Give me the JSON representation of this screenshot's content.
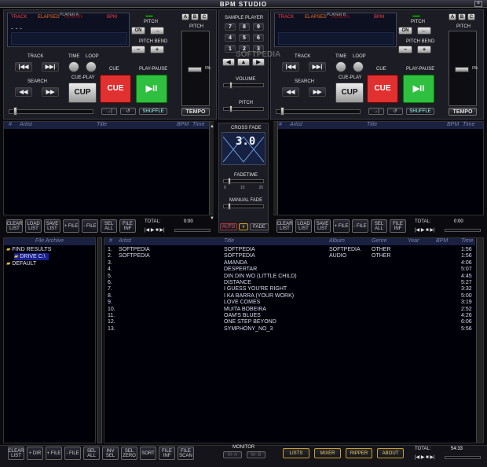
{
  "app": {
    "title": "BPM STUDIO"
  },
  "decks": [
    {
      "player_label": "PLAYER A",
      "lcd": {
        "track": "TRACK",
        "elapsed": "ELAPSED",
        "remain": "REMAIN",
        "bpm": "BPM",
        "track_value": "- - -"
      },
      "pitch": "PITCH",
      "pitch_on": "ON",
      "pitch_arrow": "→",
      "pitch_bend": "PITCH BEND",
      "minus": "−",
      "plus": "+",
      "abc": [
        "A",
        "B",
        "C"
      ],
      "track_lbl": "TRACK",
      "time_lbl": "TIME",
      "loop_lbl": "LOOP",
      "cue_lbl": "CUE",
      "play_pause_lbl": "PLAY-PAUSE",
      "cue_play_lbl": "CUE-PLAY",
      "search_lbl": "SEARCH",
      "cup": "CUP",
      "cue": "CUE",
      "play_glyph": "▶II",
      "shuffle": "SHUFFLE",
      "tempo": "TEMPO",
      "pitch_pct": "0%",
      "prev_glyph": "|◀◀",
      "next_glyph": "▶▶|",
      "rew_glyph": "◀◀",
      "fwd_glyph": "▶▶"
    },
    {
      "player_label": "PLAYER B",
      "lcd": {
        "track": "TRACK",
        "elapsed": "ELAPSED",
        "remain": "REMAIN",
        "bpm": "BPM",
        "track_value": ""
      },
      "pitch": "PITCH",
      "pitch_on": "ON",
      "pitch_arrow": "←",
      "pitch_bend": "PITCH BEND",
      "minus": "−",
      "plus": "+",
      "abc": [
        "A",
        "B",
        "C"
      ],
      "track_lbl": "TRACK",
      "time_lbl": "TIME",
      "loop_lbl": "LOOP",
      "cue_lbl": "CUE",
      "play_pause_lbl": "PLAY-PAUSE",
      "cue_play_lbl": "CUE-PLAY",
      "search_lbl": "SEARCH",
      "cup": "CUP",
      "cue": "CUE",
      "play_glyph": "▶II",
      "shuffle": "SHUFFLE",
      "tempo": "TEMPO",
      "pitch_pct": "0%",
      "prev_glyph": "|◀◀",
      "next_glyph": "▶▶|",
      "rew_glyph": "◀◀",
      "fwd_glyph": "▶▶"
    }
  ],
  "center": {
    "sample_player": "SAMPLE PLAYER",
    "pads": [
      "7",
      "8",
      "9",
      "4",
      "5",
      "6",
      "1",
      "2",
      "3"
    ],
    "volume": "VOLUME",
    "pitch": "PITCH",
    "watermark": "SOFTPEDIA",
    "crossfade": "CROSS FADE",
    "crossfade_value": "3.0",
    "fadetime": "FADETIME",
    "manual_fade": "MANUAL FADE",
    "auto": "AUTO",
    "fade": "FADE",
    "fade_scale": [
      "0",
      "10",
      "20"
    ]
  },
  "playlist_cols": {
    "num": "#",
    "artist": "Artist",
    "title": "Title",
    "bpm": "BPM",
    "time": "Time"
  },
  "playlist_buttons": [
    "CLEAR LIST",
    "LOAD LIST",
    "SAVE LIST",
    "+ FILE",
    "- FILE",
    "SEL ALL",
    "FILE INF"
  ],
  "playlist_total": {
    "label": "TOTAL:",
    "value": "0:00"
  },
  "transport_mini": "|◀ ▶ ■ ▶|",
  "archive": {
    "header": "File Archive",
    "items": [
      {
        "label": "FIND RESULTS",
        "level": 0
      },
      {
        "label": "DRIVE C:\\",
        "level": 1,
        "selected": true
      },
      {
        "label": "DEFAULT",
        "level": 0
      }
    ]
  },
  "results_cols": {
    "num": "#",
    "artist": "Artist",
    "title": "Title",
    "album": "Album",
    "genre": "Genre",
    "year": "Year",
    "bpm": "BPM",
    "time": "Time"
  },
  "results": [
    {
      "n": "1.",
      "artist": "SOFTPEDIA",
      "title": "SOFTPEDIA",
      "album": "SOFTPEDIA",
      "genre": "OTHER",
      "time": "1:56"
    },
    {
      "n": "2.",
      "artist": "SOFTPEDIA",
      "title": "SOFTPEDIA",
      "album": "AUDIO",
      "genre": "OTHER",
      "time": "1:56"
    },
    {
      "n": "3.",
      "artist": "",
      "title": "AMANDA",
      "album": "",
      "genre": "",
      "time": "4:06"
    },
    {
      "n": "4.",
      "artist": "",
      "title": "DESPERTAR",
      "album": "",
      "genre": "",
      "time": "5:07"
    },
    {
      "n": "5.",
      "artist": "",
      "title": "DIN DIN WO (LITTLE CHILD)",
      "album": "",
      "genre": "",
      "time": "4:45"
    },
    {
      "n": "6.",
      "artist": "",
      "title": "DISTANCE",
      "album": "",
      "genre": "",
      "time": "5:27"
    },
    {
      "n": "7.",
      "artist": "",
      "title": "I GUESS YOU'RE RIGHT",
      "album": "",
      "genre": "",
      "time": "3:32"
    },
    {
      "n": "8.",
      "artist": "",
      "title": "I KA BARRA (YOUR WORK)",
      "album": "",
      "genre": "",
      "time": "5:00"
    },
    {
      "n": "9.",
      "artist": "",
      "title": "LOVE COMES",
      "album": "",
      "genre": "",
      "time": "3:19"
    },
    {
      "n": "10.",
      "artist": "",
      "title": "MUITA BOBEIRA",
      "album": "",
      "genre": "",
      "time": "2:52"
    },
    {
      "n": "11.",
      "artist": "",
      "title": "OAM'S BLUES",
      "album": "",
      "genre": "",
      "time": "4:26"
    },
    {
      "n": "12.",
      "artist": "",
      "title": "ONE STEP BEYOND",
      "album": "",
      "genre": "",
      "time": "6:06"
    },
    {
      "n": "13.",
      "artist": "",
      "title": "SYMPHONY_NO_3",
      "album": "",
      "genre": "",
      "time": "5:56"
    }
  ],
  "bottom": {
    "buttons": [
      "CLEAR LIST",
      "+ DIR",
      "+ FILE",
      "- FILE",
      "SEL ALL",
      "INV SEL",
      "SEL ZERO",
      "SORT",
      "FILE INF",
      "FILE SCAN"
    ],
    "monitor": "MONITOR",
    "monitor_a": "M- A",
    "monitor_b": "M- B",
    "nav": [
      "LISTS",
      "MIXER",
      "RIPPER",
      "ABOUT"
    ],
    "total_label": "TOTAL:",
    "total_value": "54:33"
  },
  "colors": {
    "cue": "#e03030",
    "play": "#30c040",
    "accent": "#d8b000"
  }
}
